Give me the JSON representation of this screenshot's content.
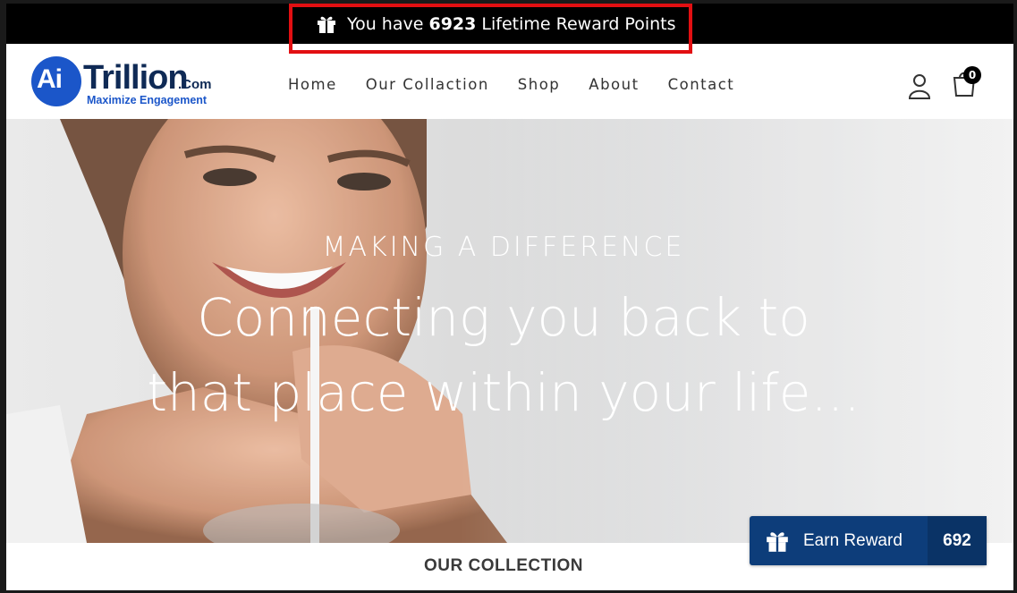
{
  "announcement": {
    "prefix": "You have",
    "points": "6923",
    "suffix": "Lifetime Reward Points",
    "icon": "gift-icon"
  },
  "logo": {
    "ai": "Ai",
    "trillion": "Trillion",
    "com": ".Com",
    "tagline": "Maximize Engagement"
  },
  "nav": {
    "items": [
      {
        "label": "Home"
      },
      {
        "label": "Our Collaction"
      },
      {
        "label": "Shop"
      },
      {
        "label": "About"
      },
      {
        "label": "Contact"
      }
    ]
  },
  "header_icons": {
    "account": "user-icon",
    "cart": "shopping-bag-icon",
    "cart_count": "0"
  },
  "hero": {
    "subtitle": "MAKING A DIFFERENCE",
    "title_line1": "Connecting you back to",
    "title_line2": "that place within your life..."
  },
  "collection": {
    "heading": "OUR COLLECTION"
  },
  "reward_widget": {
    "label": "Earn Reward",
    "points": "692",
    "icon": "gift-icon"
  },
  "colors": {
    "announcement_bg": "#000000",
    "highlight_border": "#e20f12",
    "brand_blue": "#1b56c9",
    "widget_bg": "#0d3d7a"
  }
}
